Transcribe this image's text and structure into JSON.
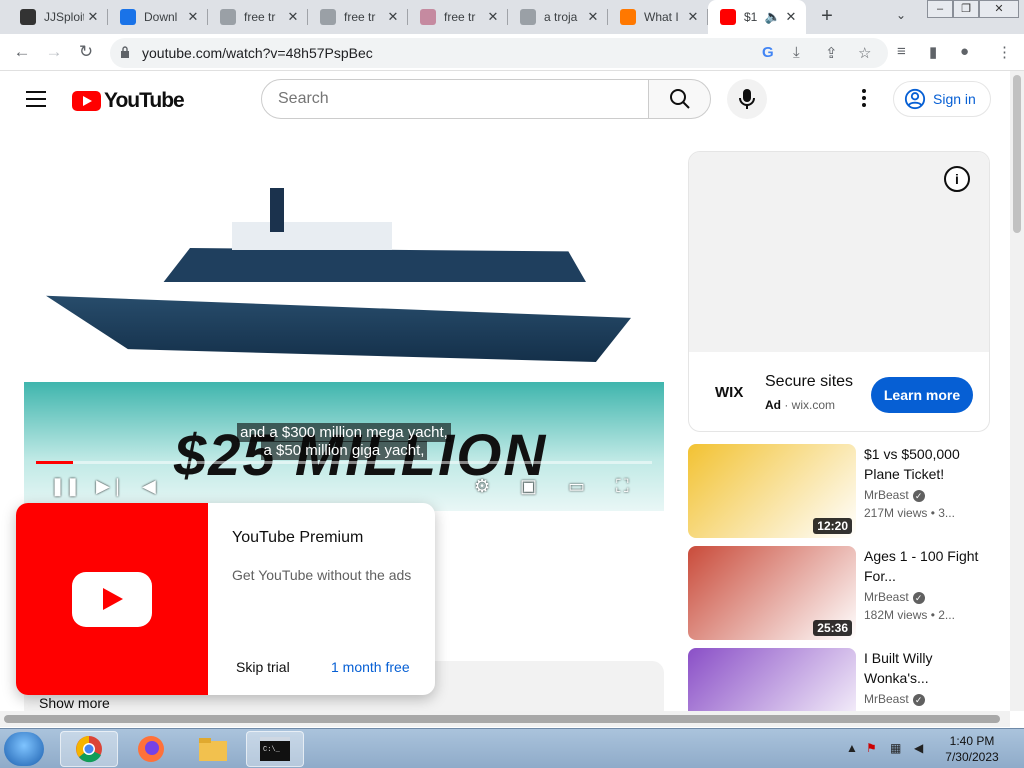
{
  "browser": {
    "tabs": [
      {
        "title": "JJSploit",
        "icon": "jjsploit-icon",
        "color": "#333333"
      },
      {
        "title": "Downl",
        "icon": "download-icon",
        "color": "#1a73e8"
      },
      {
        "title": "free tr",
        "icon": "site-icon",
        "color": "#9aa0a6"
      },
      {
        "title": "free tr",
        "icon": "site-icon",
        "color": "#9aa0a6"
      },
      {
        "title": "free tr",
        "icon": "site-icon",
        "color": "#c58aa0"
      },
      {
        "title": "a troja",
        "icon": "site-icon",
        "color": "#9aa0a6"
      },
      {
        "title": "What I",
        "icon": "avast-icon",
        "color": "#ff7800"
      },
      {
        "title": "$1",
        "icon": "youtube-icon",
        "color": "#ff0000"
      }
    ],
    "url": "youtube.com/watch?v=48h57PspBec"
  },
  "youtube": {
    "logo_text": "YouTube",
    "search_placeholder": "Search",
    "sign_in": "Sign in"
  },
  "player": {
    "captions": [
      "and a $300 million mega yacht,",
      "a $50 million giga yacht,"
    ],
    "overlay_title": "$25 MILLION",
    "progress": 0.06
  },
  "ad": {
    "logo": "WIX",
    "title": "Secure sites",
    "label": "Ad",
    "domain": "wix.com",
    "cta": "Learn more"
  },
  "recommended": [
    {
      "title": "$1 vs $500,000 Plane Ticket!",
      "channel": "MrBeast",
      "views": "217M views",
      "age": "3...",
      "duration": "12:20",
      "thumb_color": "#f2c232"
    },
    {
      "title": "Ages 1 - 100 Fight For...",
      "channel": "MrBeast",
      "views": "182M views",
      "age": "2...",
      "duration": "25:36",
      "thumb_color": "#c94b3a"
    },
    {
      "title": "I Built Willy Wonka's...",
      "channel": "MrBeast",
      "views": "",
      "age": "",
      "duration": "",
      "thumb_color": "#8a4fc7"
    }
  ],
  "premium": {
    "title": "YouTube Premium",
    "subtitle": "Get YouTube without the ads",
    "skip": "Skip trial",
    "offer": "1 month free"
  },
  "description": {
    "show_more": "Show more"
  },
  "taskbar": {
    "time": "1:40 PM",
    "date": "7/30/2023"
  }
}
